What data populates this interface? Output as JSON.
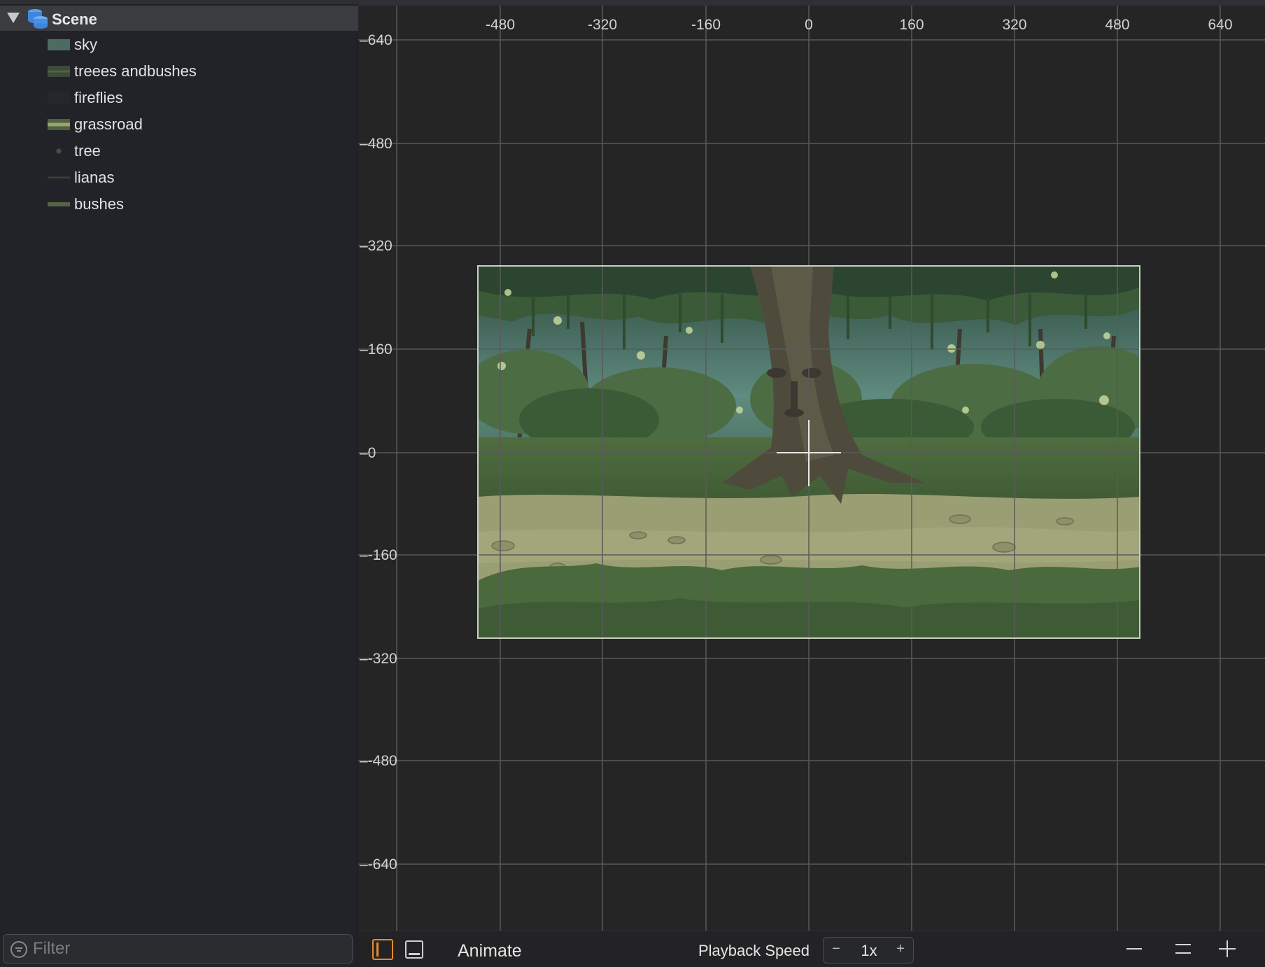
{
  "navigator": {
    "scene": {
      "label": "Scene",
      "icon": "scene-stack-icon",
      "expanded": true
    },
    "nodes": [
      {
        "label": "sky",
        "thumb_color": "#4b6b63"
      },
      {
        "label": "treees andbushes",
        "thumb_color": "#3e4a3a"
      },
      {
        "label": "fireflies",
        "thumb_color": "#2a2e30"
      },
      {
        "label": "grassroad",
        "thumb_color": "#8a9560"
      },
      {
        "label": "tree",
        "thumb_color": "#3f4438"
      },
      {
        "label": "lianas",
        "thumb_color": "#34392f"
      },
      {
        "label": "bushes",
        "thumb_color": "#4d5a42"
      }
    ],
    "filter": {
      "placeholder": "Filter",
      "value": ""
    }
  },
  "canvas": {
    "x_ticks": [
      "-480",
      "-320",
      "-160",
      "0",
      "160",
      "320",
      "480",
      "640"
    ],
    "y_ticks": [
      "640",
      "480",
      "320",
      "160",
      "0",
      "-160",
      "-320",
      "-480",
      "-640"
    ],
    "scene_frame": {
      "width": 1024,
      "height": 576,
      "center_x": 0,
      "center_y": 0
    },
    "colors": {
      "grid": "#5a5a5a",
      "background": "#252526",
      "frame": "#c8d0c0"
    }
  },
  "toolbar": {
    "animate_label": "Animate",
    "playback_label": "Playback Speed",
    "speed_value": "1x",
    "minus": "−",
    "plus": "+",
    "accent": "#e8892b"
  }
}
